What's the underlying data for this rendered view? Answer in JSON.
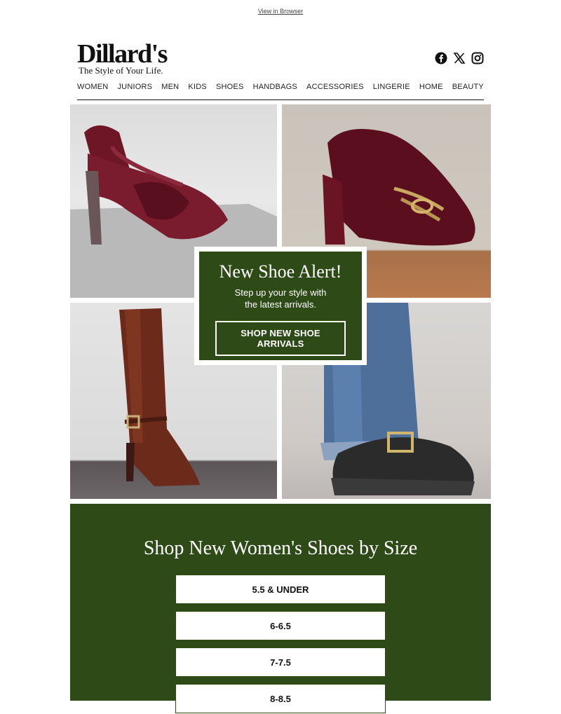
{
  "topbar": {
    "view_in_browser": "View in Browser"
  },
  "header": {
    "brand": "Dillard's",
    "tagline": "The Style of Your Life.",
    "social": [
      "facebook-icon",
      "x-icon",
      "instagram-icon"
    ]
  },
  "nav": {
    "items": [
      "WOMEN",
      "JUNIORS",
      "MEN",
      "KIDS",
      "SHOES",
      "HANDBAGS",
      "ACCESSORIES",
      "LINGERIE",
      "HOME",
      "BEAUTY"
    ]
  },
  "hero": {
    "title": "New Shoe Alert!",
    "subtitle_line1": "Step up your style with",
    "subtitle_line2": "the latest arrivals.",
    "cta": "SHOP NEW SHOE ARRIVALS",
    "images": [
      "burgundy velvet slingback pump",
      "burgundy croc loafer pump",
      "brown knee-high boot",
      "black logo clog"
    ]
  },
  "sizes": {
    "heading": "Shop New Women's Shoes by Size",
    "buttons": [
      "5.5 & UNDER",
      "6-6.5",
      "7-7.5",
      "8-8.5"
    ]
  },
  "colors": {
    "accent_green": "#2e4a17"
  }
}
